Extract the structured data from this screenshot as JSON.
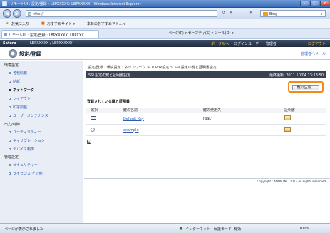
{
  "window": {
    "title": "リモートUI : 設定/登録 : LBPXXXXX: LBPXXXXX - Windows Internet Explorer"
  },
  "address": {
    "url": "http://",
    "search_placeholder": "Bing"
  },
  "favorites": {
    "label": "お気に入り",
    "item1": "おすすめサイト ▾",
    "item2": "本日のおすすめアト... ▾"
  },
  "tab": {
    "label": "リモートUI : 設定/登録 : LBPXXXXX: LBPXXX..."
  },
  "commands": {
    "text": "ページ(P) ▾  セーフティ(S) ▾  ツール(O) ▾"
  },
  "header": {
    "brand": "Satera",
    "device": "LBPXXXXX / LBPXXXXX/",
    "portal": "ポータルへ",
    "login_user": "ログインユーザー : 管理者",
    "logout": "ログアウト"
  },
  "subheader": {
    "title": "設定/登録",
    "mail_link": "管理者へメール"
  },
  "sidebar": {
    "sections": [
      {
        "label": "環境設定",
        "items": [
          "各種情報",
          "給紙",
          "ネットワーク",
          "レイアウト",
          "印字調整",
          "ユーザーメンテナンス"
        ]
      },
      {
        "label": "出力/制御",
        "items": [
          "ユーティリティー",
          "キャリブレーション",
          "デバイス制御"
        ]
      },
      {
        "label": "管理設定",
        "items": [
          "セキュリティー",
          "ライセンス/その他"
        ]
      }
    ]
  },
  "main": {
    "breadcrumb": "設定/登録 : 環境設定 : ネットワーク > TCP/IP設定 > SSL設定の鍵と証明書設定",
    "panel_title": "SSL設定の鍵と証明書設定",
    "updated": "最終更新: 2011 10/04 13:13:50",
    "generate_button": "鍵の生成...",
    "section_title": "登録されている鍵と証明書",
    "columns": [
      "選択",
      "鍵の名前",
      "鍵の使用先",
      "証明書"
    ],
    "rows": [
      {
        "key_name": "Default Key",
        "usage": "[SSL]",
        "selected": true
      },
      {
        "key_name": "example",
        "usage": "",
        "selected": false
      }
    ],
    "copyright": "Copyright CANON INC. 2012 All Rights Reserved"
  },
  "status": {
    "left": "ページが表示されました",
    "zone": "インターネット | 保護モード: 有効",
    "zoom": "100%"
  }
}
